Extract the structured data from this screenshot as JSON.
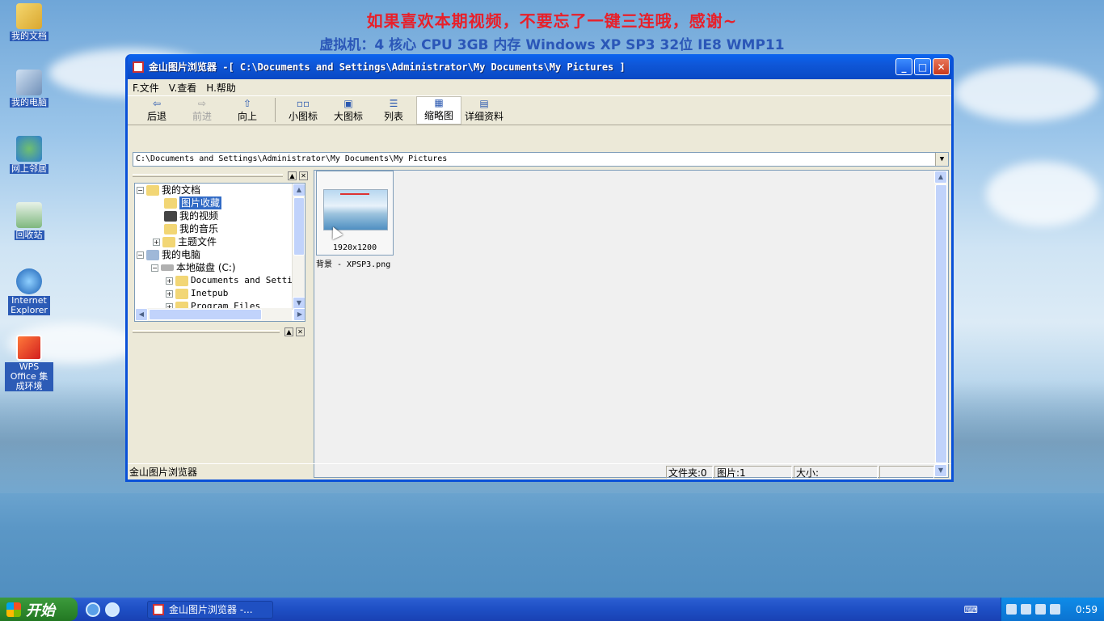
{
  "banner": {
    "line1": "如果喜欢本期视频，不要忘了一键三连哦，感谢~",
    "line2": "虚拟机：4 核心 CPU   3GB 内存   Windows XP SP3 32位   IE8   WMP11"
  },
  "desktop": {
    "icons": [
      {
        "label": "我的文档",
        "icon": "my-documents-icon"
      },
      {
        "label": "我的电脑",
        "icon": "my-computer-icon"
      },
      {
        "label": "网上邻居",
        "icon": "network-icon"
      },
      {
        "label": "回收站",
        "icon": "recycle-bin-icon"
      },
      {
        "label": "Internet Explorer",
        "icon": "ie-icon"
      },
      {
        "label": "WPS Office 集成环境",
        "icon": "wps-icon"
      }
    ]
  },
  "window": {
    "title": "金山图片浏览器 -[ C:\\Documents and Settings\\Administrator\\My Documents\\My Pictures ]",
    "menu": [
      "F.文件",
      "V.查看",
      "H.帮助"
    ],
    "toolbar": [
      {
        "label": "后退",
        "glyph": "⇦",
        "enabled": true
      },
      {
        "label": "前进",
        "glyph": "⇨",
        "enabled": false
      },
      {
        "label": "向上",
        "glyph": "⇧",
        "enabled": true
      },
      {
        "label": "小图标",
        "glyph": "▫▫",
        "enabled": true
      },
      {
        "label": "大图标",
        "glyph": "▣",
        "enabled": true
      },
      {
        "label": "列表",
        "glyph": "☰",
        "enabled": true
      },
      {
        "label": "缩略图",
        "glyph": "▦",
        "enabled": true,
        "active": true
      },
      {
        "label": "详细资料",
        "glyph": "▤",
        "enabled": true
      }
    ],
    "address": "C:\\Documents and Settings\\Administrator\\My Documents\\My Pictures",
    "tree": [
      {
        "label": "我的文档",
        "expander": "−"
      },
      {
        "label": "图片收藏",
        "selected": true
      },
      {
        "label": "我的视频"
      },
      {
        "label": "我的音乐"
      },
      {
        "label": "主题文件",
        "expander": "+"
      },
      {
        "label": "我的电脑",
        "expander": "−"
      },
      {
        "label": "本地磁盘 (C:)",
        "expander": "−"
      },
      {
        "label": "Documents and Setti",
        "expander": "+"
      },
      {
        "label": "Inetpub",
        "expander": "+"
      },
      {
        "label": "Program Files",
        "expander": "+"
      }
    ],
    "thumbnail": {
      "dimensions": "1920x1200",
      "filename": "背景 - XPSP3.png"
    },
    "status": {
      "app": "金山图片浏览器",
      "folders": "文件夹:0",
      "pictures": "图片:1",
      "size": "大小:"
    }
  },
  "taskbar": {
    "start": "开始",
    "task": "金山图片浏览器 -...",
    "clock": "0:59"
  }
}
